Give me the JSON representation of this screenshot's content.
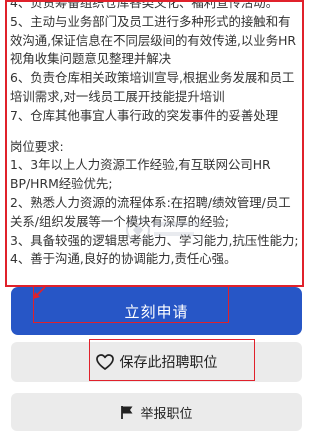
{
  "description_lines": [
    "4、负责筹备组织仓库各类文化、福利宣传活动。",
    "5、主动与业务部门及员工进行多种形式的接触和有",
    "效沟通,保证信息在不同层级间的有效传递,以业务HR",
    "视角收集问题意见整理并解决",
    "6、负责仓库相关政策培训宣导,根据业务发展和员工",
    "培训需求,对一线员工展开技能提升培训",
    "7、仓库其他事宜人事行政的突发事件的妥善处理"
  ],
  "requirements_title": "岗位要求:",
  "requirement_lines": [
    "1、3年以上人力资源工作经验,有互联网公司HR",
    "BP/HRM经验优先;",
    "2、熟悉人力资源的流程体系:在招聘/绩效管理/员工",
    "关系/组织发展等一个模块有深厚的经验;",
    "3、具备较强的逻辑思考能力、学习能力,抗压性能力;",
    "4、善于沟通,良好的协调能力,责任心强。"
  ],
  "actions": {
    "apply_label": "立刻申请",
    "save_label": "保存此招聘职位",
    "report_label": "举报职位"
  },
  "colors": {
    "primary_button": "#2756c6",
    "secondary_button": "#ebebeb",
    "annotation_red": "#e0212b"
  },
  "icons": {
    "save": "heart-icon",
    "report": "flag-icon",
    "annotation": "arrow-icon"
  }
}
